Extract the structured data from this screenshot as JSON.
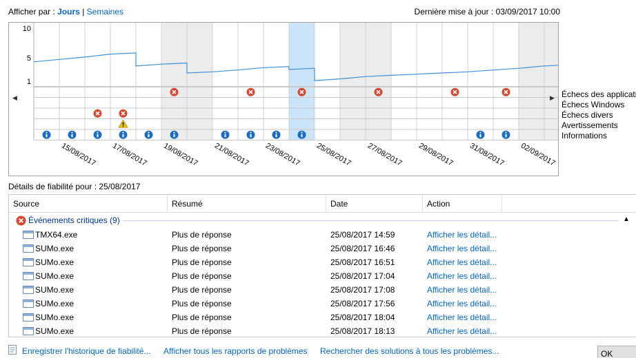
{
  "header": {
    "view_by_label": "Afficher par :",
    "view_days": "Jours",
    "view_separator": "|",
    "view_weeks": "Semaines",
    "last_update": "Dernière mise à jour : 03/09/2017 10:00"
  },
  "chart": {
    "y_ticks": [
      "10",
      "5",
      "1"
    ],
    "x_labels": [
      "15/08/2017",
      "17/08/2017",
      "19/08/2017",
      "21/08/2017",
      "23/08/2017",
      "25/08/2017",
      "27/08/2017",
      "29/08/2017",
      "31/08/2017",
      "02/09/2017"
    ],
    "legend": [
      "Échecs des applications",
      "Échecs Windows",
      "Échecs divers",
      "Avertissements",
      "Informations"
    ],
    "selected_day_index": 10,
    "colors": {
      "line": "#3c8fdc",
      "selected": "#cce4f7",
      "weekend": "#ececec",
      "error": "#d9462e",
      "info": "#1c6dc0",
      "warning": "#f2c400"
    }
  },
  "chart_data": {
    "type": "line",
    "title": "",
    "xlabel": "",
    "ylabel": "",
    "ylim": [
      1,
      10
    ],
    "x": [
      "14/08/2017",
      "15/08/2017",
      "16/08/2017",
      "17/08/2017",
      "18/08/2017",
      "19/08/2017",
      "20/08/2017",
      "21/08/2017",
      "22/08/2017",
      "23/08/2017",
      "24/08/2017",
      "25/08/2017",
      "26/08/2017",
      "27/08/2017",
      "28/08/2017",
      "29/08/2017",
      "30/08/2017",
      "31/08/2017",
      "01/09/2017",
      "02/09/2017",
      "03/09/2017"
    ],
    "series": [
      {
        "values": [
          4.3,
          4.7,
          5.1,
          5.6,
          3.6,
          3.9,
          2.4,
          2.6,
          2.9,
          3.3,
          3.0,
          1.1,
          1.4,
          1.8,
          2.0,
          2.2,
          2.4,
          2.6,
          2.9,
          3.2,
          3.6
        ]
      }
    ],
    "events": {
      "application_failures": [
        "19/08/2017",
        "22/08/2017",
        "24/08/2017",
        "27/08/2017",
        "30/08/2017",
        "01/09/2017"
      ],
      "misc_failures": [
        "16/08/2017",
        "17/08/2017"
      ],
      "warnings": [
        "17/08/2017"
      ],
      "informations": [
        "14/08/2017",
        "15/08/2017",
        "16/08/2017",
        "17/08/2017",
        "18/08/2017",
        "19/08/2017",
        "21/08/2017",
        "22/08/2017",
        "23/08/2017",
        "24/08/2017",
        "31/08/2017",
        "01/09/2017"
      ]
    }
  },
  "details": {
    "title": "Détails de fiabilité pour : 25/08/2017",
    "columns": {
      "source": "Source",
      "summary": "Résumé",
      "date": "Date",
      "action": "Action"
    },
    "group_label": "Événements critiques (9)",
    "rows": [
      {
        "source": "TMX64.exe",
        "summary": "Plus de réponse",
        "date": "25/08/2017 14:59",
        "action": "Afficher les détail..."
      },
      {
        "source": "SUMo.exe",
        "summary": "Plus de réponse",
        "date": "25/08/2017 16:46",
        "action": "Afficher les détail..."
      },
      {
        "source": "SUMo.exe",
        "summary": "Plus de réponse",
        "date": "25/08/2017 16:51",
        "action": "Afficher les détail..."
      },
      {
        "source": "SUMo.exe",
        "summary": "Plus de réponse",
        "date": "25/08/2017 17:04",
        "action": "Afficher les détail..."
      },
      {
        "source": "SUMo.exe",
        "summary": "Plus de réponse",
        "date": "25/08/2017 17:08",
        "action": "Afficher les détail..."
      },
      {
        "source": "SUMo.exe",
        "summary": "Plus de réponse",
        "date": "25/08/2017 17:56",
        "action": "Afficher les détail..."
      },
      {
        "source": "SUMo.exe",
        "summary": "Plus de réponse",
        "date": "25/08/2017 18:04",
        "action": "Afficher les détail..."
      },
      {
        "source": "SUMo.exe",
        "summary": "Plus de réponse",
        "date": "25/08/2017 18:13",
        "action": "Afficher les détail..."
      }
    ]
  },
  "footer": {
    "save_history": "Enregistrer l'historique de fiabilité...",
    "view_reports": "Afficher tous les rapports de problèmes",
    "check_solutions": "Rechercher des solutions à tous les problèmes...",
    "ok": "OK"
  }
}
